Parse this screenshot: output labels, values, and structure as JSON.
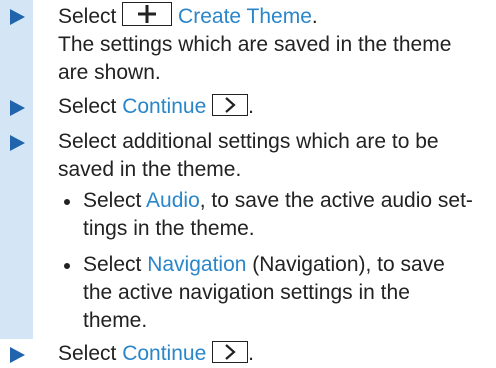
{
  "accent_color": "#2a86c9",
  "band_color": "#d4e6f6",
  "arrow_color": "#1f64ad",
  "step1": {
    "prefix": "Select ",
    "button_icon": "plus-icon",
    "link": "Create Theme",
    "suffix": ".",
    "desc": "The settings which are saved in the theme are shown."
  },
  "step2": {
    "prefix": "Select ",
    "link": "Continue",
    "button_icon": "chevron-right-icon",
    "suffix": "."
  },
  "step3": {
    "text": "Select additional settings which are to be saved in the theme."
  },
  "sub1": {
    "prefix": "Select ",
    "link": "Audio",
    "text": ", to save the active audio set-tings in the theme."
  },
  "sub2": {
    "prefix": "Select ",
    "link": "Navigation",
    "text": " (Navigation), to save the active navigation settings in the theme."
  },
  "step4": {
    "prefix": "Select ",
    "link": "Continue",
    "button_icon": "chevron-right-icon",
    "suffix": "."
  }
}
